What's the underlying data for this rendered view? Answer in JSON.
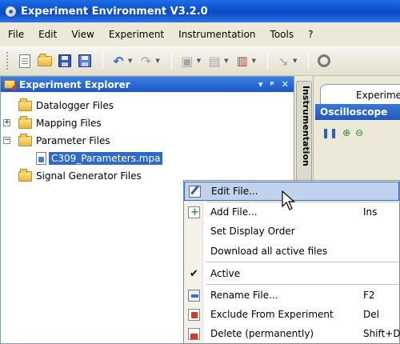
{
  "window": {
    "title": "Experiment Environment V3.2.0"
  },
  "menubar": {
    "items": [
      "File",
      "Edit",
      "View",
      "Experiment",
      "Instrumentation",
      "Tools",
      "?"
    ]
  },
  "toolbar": {
    "icons": [
      "new-document-icon",
      "open-folder-icon",
      "save-icon",
      "save-all-icon",
      "undo-icon",
      "redo-icon",
      "tool-a-icon",
      "tool-b-icon",
      "tool-c-icon",
      "tool-d-icon",
      "settings-icon"
    ]
  },
  "explorer": {
    "title": "Experiment Explorer",
    "controls": {
      "dropdown": "▾",
      "pin": "ᵖ",
      "close": "✕"
    },
    "tree": [
      {
        "label": "Datalogger Files",
        "type": "folder",
        "expander": ""
      },
      {
        "label": "Mapping Files",
        "type": "folder",
        "expander": "+"
      },
      {
        "label": "Parameter Files",
        "type": "folder",
        "expander": "−"
      },
      {
        "label": "C309_Parameters.mpa",
        "type": "file",
        "selected": true
      },
      {
        "label": "Signal Generator Files",
        "type": "folder",
        "expander": ""
      }
    ]
  },
  "instrumentation": {
    "label": "Instrumentation"
  },
  "document": {
    "tab_label": "Experiment",
    "panel_title": "Oscilloscope"
  },
  "context_menu": {
    "items": [
      {
        "label": "Edit File...",
        "shortcut": "",
        "icon": "edit-icon",
        "highlighted": true
      },
      {
        "label": "Add File...",
        "shortcut": "Ins",
        "icon": "add-file-icon"
      },
      {
        "label": "Set Display Order",
        "shortcut": ""
      },
      {
        "label": "Download all active files",
        "shortcut": ""
      },
      {
        "label": "Active",
        "shortcut": "",
        "checked": true
      },
      {
        "label": "Rename File...",
        "shortcut": "F2",
        "icon": "rename-icon"
      },
      {
        "label": "Exclude From Experiment",
        "shortcut": "Del",
        "icon": "exclude-icon"
      },
      {
        "label": "Delete (permanently)",
        "shortcut": "Shift+Del",
        "icon": "delete-icon"
      }
    ]
  },
  "colors": {
    "selection": "#316ac5",
    "title_bar": "#0a4fcf",
    "menu_highlight": "#c1d2ee"
  }
}
